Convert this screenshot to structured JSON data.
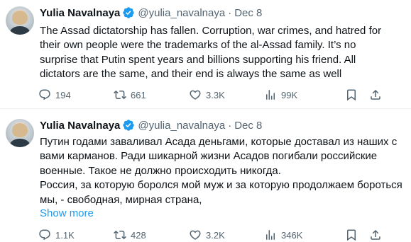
{
  "tweets": [
    {
      "name": "Yulia Navalnaya",
      "handle": "@yulia_navalnaya",
      "separator": "·",
      "date": "Dec 8",
      "lines": [
        "The Assad dictatorship has fallen. Corruption, war crimes, and hatred for",
        "their own people were the trademarks of the al-Assad family. It’s no",
        "surprise that Putin spent years and billions supporting his friend. All",
        "dictators are the same, and their end is always the same as well"
      ],
      "replies": "194",
      "reposts": "661",
      "likes": "3.3K",
      "views": "99K"
    },
    {
      "name": "Yulia Navalnaya",
      "handle": "@yulia_navalnaya",
      "separator": "·",
      "date": "Dec 8",
      "lines": [
        "Путин годами заваливал Асада деньгами, которые доставал из наших с",
        "вами карманов. Ради шикарной жизни Асадов погибали российские",
        "военные. Такое не должно происходить никогда.",
        "Россия, за которую боролся мой муж и за которую продолжаем бороться",
        "мы, - свободная, мирная страна,"
      ],
      "show_more": "Show more",
      "replies": "1.1K",
      "reposts": "428",
      "likes": "3.2K",
      "views": "346K"
    }
  ],
  "colors": {
    "text": "#0f1419",
    "secondary": "#536471",
    "link": "#1d9bf0",
    "verified": "#1d9bf0",
    "divider": "#eff3f4"
  },
  "icons": [
    "verified-badge-icon",
    "reply-icon",
    "repost-icon",
    "like-icon",
    "views-icon",
    "bookmark-icon",
    "share-icon"
  ]
}
